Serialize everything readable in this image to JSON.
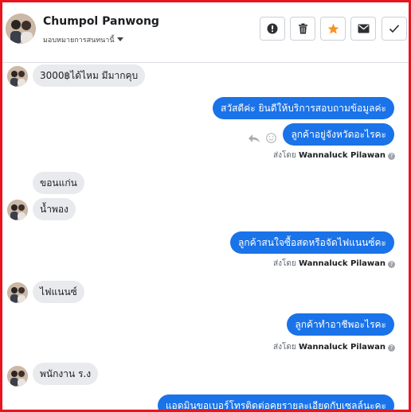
{
  "header": {
    "contact_name": "Chumpol Panwong",
    "assign_label": "มอบหมายการสนทนานี้",
    "buttons": [
      {
        "name": "alert-icon"
      },
      {
        "name": "trash-icon"
      },
      {
        "name": "star-icon",
        "color": "#f7931e"
      },
      {
        "name": "envelope-icon"
      },
      {
        "name": "check-icon"
      }
    ]
  },
  "messages": [
    {
      "dir": "in",
      "text": "3000฿ได้ไหม มีมากคุบ",
      "avatar": true
    },
    {
      "dir": "out",
      "text": "สวัสดีค่ะ  ยินดีให้บริการสอบถามข้อมูลค่ะ"
    },
    {
      "dir": "out",
      "text": "ลูกค้าอยู่จังหวัดอะไรคะ"
    },
    {
      "dir": "in",
      "text": "ขอนแก่น",
      "avatar": false
    },
    {
      "dir": "in",
      "text": "น้ำพอง",
      "avatar": true
    },
    {
      "dir": "out",
      "text": "ลูกค้าสนใจซื้อสดหรือจัดไฟแนนซ์คะ"
    },
    {
      "dir": "in",
      "text": "ไฟแนนซ์",
      "avatar": true
    },
    {
      "dir": "out",
      "text": "ลูกค้าทำอาชีพอะไรคะ"
    },
    {
      "dir": "in",
      "text": "พนักงาน ร.ง",
      "avatar": true
    },
    {
      "dir": "out",
      "text": "แอดมินขอเบอร์โทรติดต่อคุยรายละเอียดกับเซลล์นะคะ"
    }
  ],
  "sent_by": {
    "prefix": "ส่งโดย",
    "agent": "Wannaluck Pilawan"
  }
}
